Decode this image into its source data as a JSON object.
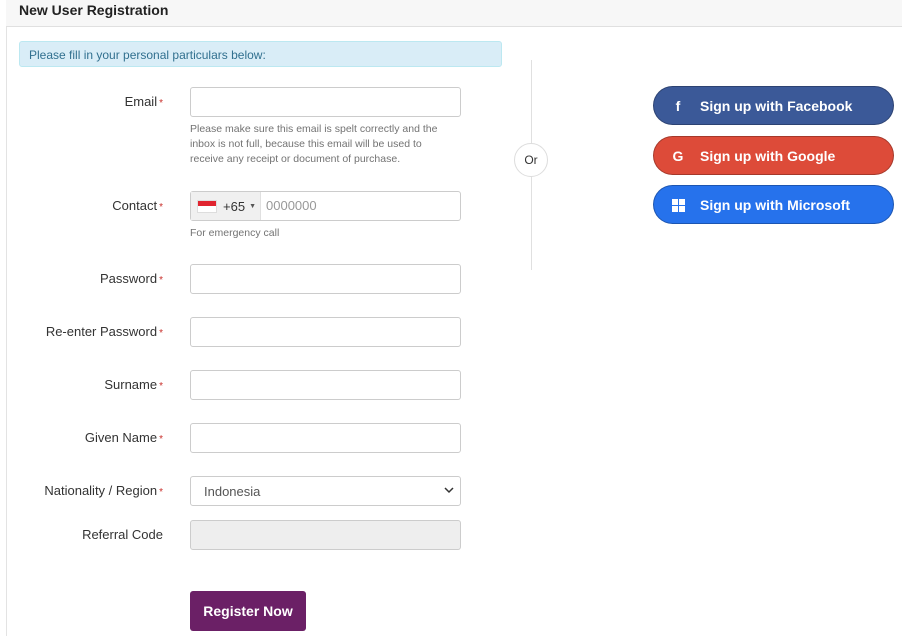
{
  "header": {
    "title": "New User Registration"
  },
  "info_message": "Please fill in your personal particulars below:",
  "form": {
    "email": {
      "label": "Email",
      "value": "",
      "help": [
        "Please make sure this email is spelt correctly and the",
        "inbox is not full, because this email will be used to",
        "receive any receipt or document of purchase."
      ]
    },
    "contact": {
      "label": "Contact",
      "dial_code": "+65",
      "placeholder": "0000000",
      "help": "For emergency call"
    },
    "password": {
      "label": "Password",
      "value": ""
    },
    "reenter_password": {
      "label": "Re-enter Password",
      "value": ""
    },
    "surname": {
      "label": "Surname",
      "value": ""
    },
    "given_name": {
      "label": "Given Name",
      "value": ""
    },
    "nationality": {
      "label": "Nationality / Region",
      "value": "Indonesia"
    },
    "referral": {
      "label": "Referral Code",
      "value": ""
    },
    "required_mark": "*",
    "submit_label": "Register Now"
  },
  "divider_label": "Or",
  "social": {
    "facebook": {
      "label": "Sign up with Facebook",
      "color": "#3b5998",
      "icon": "facebook-icon"
    },
    "google": {
      "label": "Sign up with Google",
      "color": "#dd4b39",
      "icon": "google-icon"
    },
    "microsoft": {
      "label": "Sign up with Microsoft",
      "color": "#2672ec",
      "icon": "microsoft-icon"
    }
  },
  "colors": {
    "primary": "#6b2066",
    "info_bg": "#d9edf7",
    "info_text": "#31708f",
    "required": "#c9302c"
  }
}
